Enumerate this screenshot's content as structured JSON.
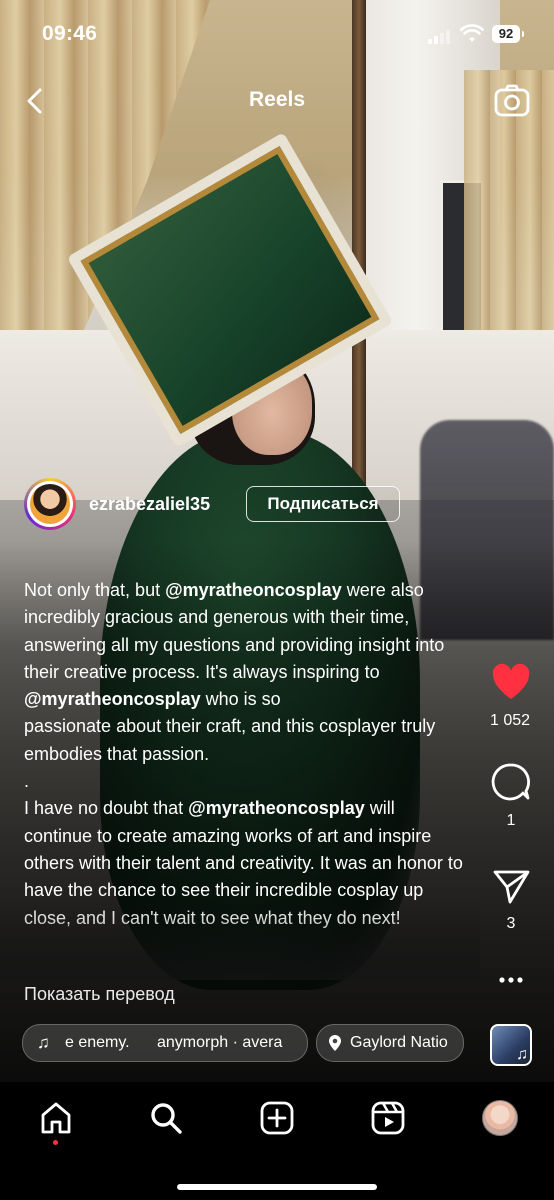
{
  "status_bar": {
    "time": "09:46",
    "battery": "92"
  },
  "header": {
    "title": "Reels"
  },
  "post": {
    "username": "ezrabezaliel35",
    "follow_label": "Подписаться",
    "caption": {
      "p1_before": "Not only that, but ",
      "p1_mention": "@myratheoncosplay",
      "p1_after": " were also incredibly gracious and generous with their time, answering all my questions and providing insight into their creative process. It's always inspiring to ",
      "p1_mention2": "@myratheoncosplay",
      "p1_after2": " who is so\npassionate about their craft, and this cosplayer truly embodies that passion.\n.",
      "p2_before": "I have no doubt that ",
      "p2_mention": "@myratheoncosplay",
      "p2_after": " will continue to create amazing works of art and inspire others with their talent and creativity. It was an honor to have the chance to see their incredible cosplay up close, and I can't wait to see what they do next!"
    },
    "translate_label": "Показать перевод",
    "music": {
      "track": "e enemy.",
      "artist": "anymorph · avera"
    },
    "location": "Gaylord Natio"
  },
  "actions": {
    "likes": "1 052",
    "comments": "1",
    "shares": "3",
    "like_color": "#ff3040"
  },
  "icons": {
    "back": "chevron-left-icon",
    "camera": "camera-icon",
    "like": "heart-icon",
    "comment": "comment-bubble-icon",
    "share": "paper-plane-icon",
    "more": "ellipsis-icon",
    "home": "home-icon",
    "search": "search-icon",
    "create": "plus-square-icon",
    "reels": "reels-icon",
    "profile": "profile-avatar"
  }
}
